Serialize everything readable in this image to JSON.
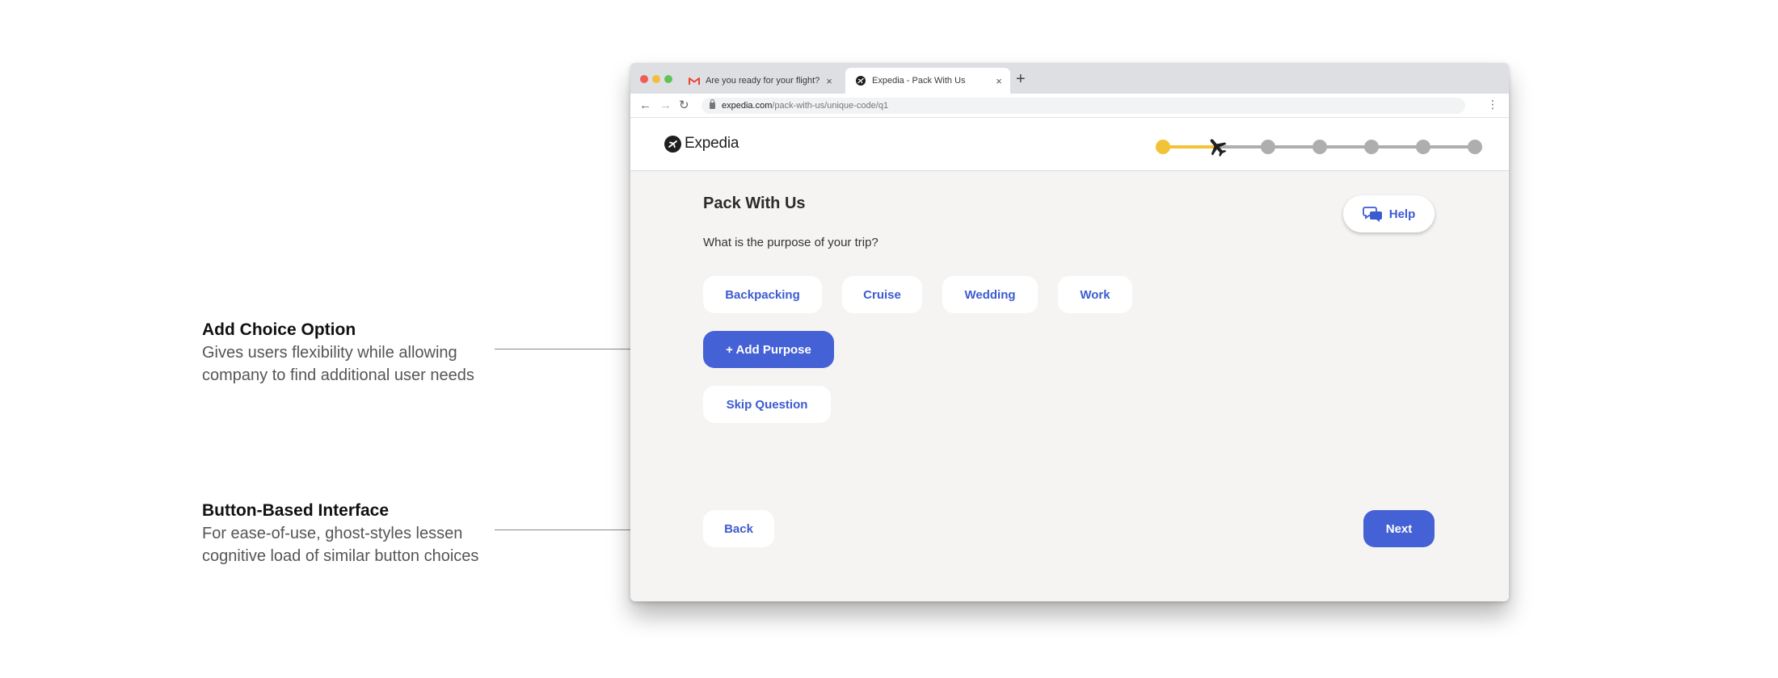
{
  "annotations": [
    {
      "title": "Add Choice Option",
      "lines": [
        "Gives users flexibility while allowing",
        "company to find additional user needs"
      ]
    },
    {
      "title": "Button-Based Interface",
      "lines": [
        "For ease-of-use, ghost-styles lessen",
        "cognitive load of similar button choices"
      ]
    }
  ],
  "browser": {
    "tabs": [
      {
        "title": "Are you ready for your flight?",
        "favicon": "gmail-icon",
        "close": "×"
      },
      {
        "title": "Expedia - Pack With Us",
        "favicon": "expedia-icon",
        "close": "×",
        "active": true
      }
    ],
    "new_tab": "+",
    "nav": {
      "back": "←",
      "forward": "→",
      "reload": "↻",
      "menu": "⋮"
    },
    "url_domain": "expedia.com",
    "url_path": "/pack-with-us/unique-code/q1"
  },
  "header": {
    "logo_text": "Expedia",
    "progress": {
      "total_steps": 7,
      "current_step": 2,
      "current_icon": "plane-icon"
    }
  },
  "main": {
    "title": "Pack With Us",
    "help_label": "Help",
    "question": "What is the purpose of your trip?",
    "choices": [
      "Backpacking",
      "Cruise",
      "Wedding",
      "Work"
    ],
    "add_label": "+ Add Purpose",
    "skip_label": "Skip Question",
    "back_label": "Back",
    "next_label": "Next"
  },
  "colors": {
    "primary": "#4461d6",
    "link_text": "#3d5bd0",
    "accent_yellow": "#f2c337",
    "progress_gray": "#aeaeae",
    "page_bg": "#f5f4f2"
  }
}
